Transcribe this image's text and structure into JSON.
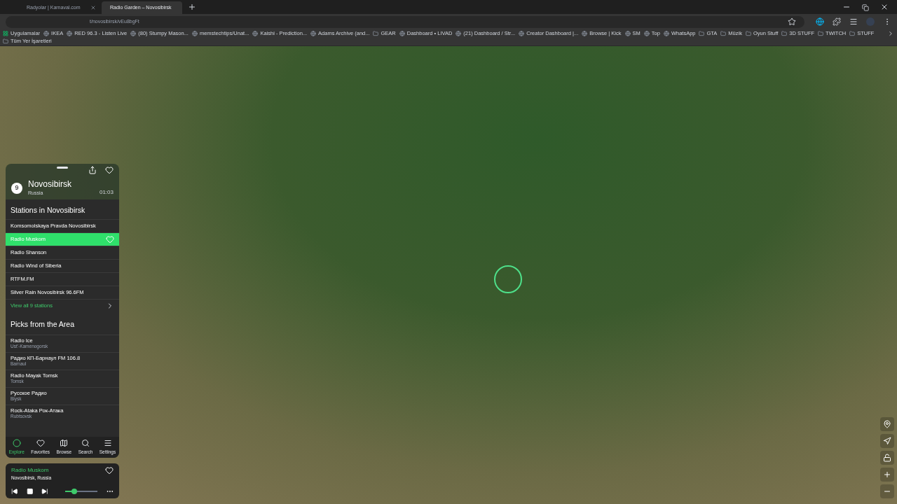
{
  "browser": {
    "tabs": [
      {
        "title": "Radyolar | Karnaval.com",
        "selected": false
      },
      {
        "title": "Radio Garden – Novosibirsk",
        "selected": true
      }
    ],
    "url": "t/novosibirsk/vEu8bgFt",
    "bookmarks": [
      {
        "kind": "apps",
        "label": "Uygulamalar"
      },
      {
        "kind": "site",
        "label": "IKEA"
      },
      {
        "kind": "site",
        "label": "RED 96.3 - Listen Live"
      },
      {
        "kind": "site",
        "label": "(80) Stumpy Mason..."
      },
      {
        "kind": "site",
        "label": "memstechtips/Unat..."
      },
      {
        "kind": "site",
        "label": "Kaishi - Prediction..."
      },
      {
        "kind": "site",
        "label": "Adams Archive (and..."
      },
      {
        "kind": "folder",
        "label": "GEAR"
      },
      {
        "kind": "site",
        "label": "Dashboard • LIVAD"
      },
      {
        "kind": "site",
        "label": "(21) Dashboard / Str..."
      },
      {
        "kind": "site",
        "label": "Creator Dashboard |..."
      },
      {
        "kind": "site",
        "label": "Browse | Kick"
      },
      {
        "kind": "site",
        "label": "SM"
      },
      {
        "kind": "site",
        "label": "Top"
      },
      {
        "kind": "site",
        "label": "WhatsApp"
      },
      {
        "kind": "folder",
        "label": "GTA"
      },
      {
        "kind": "folder",
        "label": "Müzik"
      },
      {
        "kind": "folder",
        "label": "Oyun Stuff"
      },
      {
        "kind": "folder",
        "label": "3D STUFF"
      },
      {
        "kind": "folder",
        "label": "TWITCH"
      },
      {
        "kind": "folder",
        "label": "STUFF"
      }
    ],
    "all_bookmarks": "Tüm Yer İşaretleri"
  },
  "place": {
    "count": "9",
    "city": "Novosibirsk",
    "country": "Russia",
    "time": "01:03"
  },
  "stations": {
    "title": "Stations in Novosibirsk",
    "items": [
      {
        "name": "Komsomolskaya Pravda Novosibirsk",
        "selected": false
      },
      {
        "name": "Radio Muskom",
        "selected": true
      },
      {
        "name": "Radio Shanson",
        "selected": false
      },
      {
        "name": "Radio Wind of Siberia",
        "selected": false
      },
      {
        "name": "RTFM.FM",
        "selected": false
      },
      {
        "name": "Silver Rain Novosibirsk 96.6FM",
        "selected": false
      }
    ],
    "view_all": "View all 9 stations"
  },
  "picks": {
    "title": "Picks from the Area",
    "items": [
      {
        "name": "Radio Ice",
        "place": "Ust'-Kamenogorsk"
      },
      {
        "name": "Радио КП-Барнаул FM 106.8",
        "place": "Barnaul"
      },
      {
        "name": "Radio Mayak Tomsk",
        "place": "Tomsk"
      },
      {
        "name": "Русское Радио",
        "place": "Biysk"
      },
      {
        "name": "Rock-Ataka Рок-Атака",
        "place": "Rubtsovsk"
      }
    ]
  },
  "nav": [
    {
      "label": "Explore",
      "selected": true
    },
    {
      "label": "Favorites",
      "selected": false
    },
    {
      "label": "Browse",
      "selected": false
    },
    {
      "label": "Search",
      "selected": false
    },
    {
      "label": "Settings",
      "selected": false
    }
  ],
  "player": {
    "station": "Radio Muskom",
    "place": "Novosibirsk, Russia",
    "volume": {
      "level": 0.3
    }
  }
}
